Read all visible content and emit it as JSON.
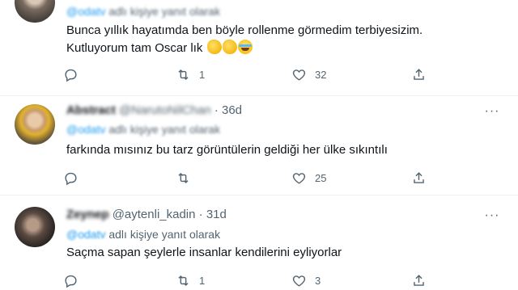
{
  "tweets": [
    {
      "display_name": "",
      "handle": "",
      "time": "",
      "replying_prefix": "@odatv",
      "replying_suffix": "adlı kişiye yanıt olarak",
      "text_lines": [
        "Bunca yıllık hayatımda ben böyle rollenme görmedim terbiyesizim.",
        "Kutluyorum tam Oscar lık"
      ],
      "emojis": [
        "clapping-hands",
        "clapping-hands",
        "tears-of-joy"
      ],
      "reply_count": "",
      "retweet_count": "1",
      "like_count": "32"
    },
    {
      "display_name": "Abstract",
      "handle": "@NarutoNilChan",
      "time": "36d",
      "replying_prefix": "@odatv",
      "replying_suffix": "adlı kişiye yanıt olarak",
      "text_lines": [
        "farkında mısınız bu tarz görüntülerin geldiği her ülke sıkıntılı"
      ],
      "reply_count": "",
      "retweet_count": "",
      "like_count": "25"
    },
    {
      "display_name": "Zeynep",
      "handle": "@aytenli_kadin",
      "time": "31d",
      "replying_prefix": "@odatv",
      "replying_suffix": "adlı kişiye yanıt olarak",
      "text_lines": [
        "Saçma sapan şeylerle insanlar kendilerini eyliyorlar"
      ],
      "reply_count": "",
      "retweet_count": "1",
      "like_count": "3"
    }
  ],
  "separator": "·",
  "more_glyph": "···",
  "colors": {
    "link": "#1d9bf0",
    "secondary": "#536471",
    "divider": "#eff3f4"
  }
}
